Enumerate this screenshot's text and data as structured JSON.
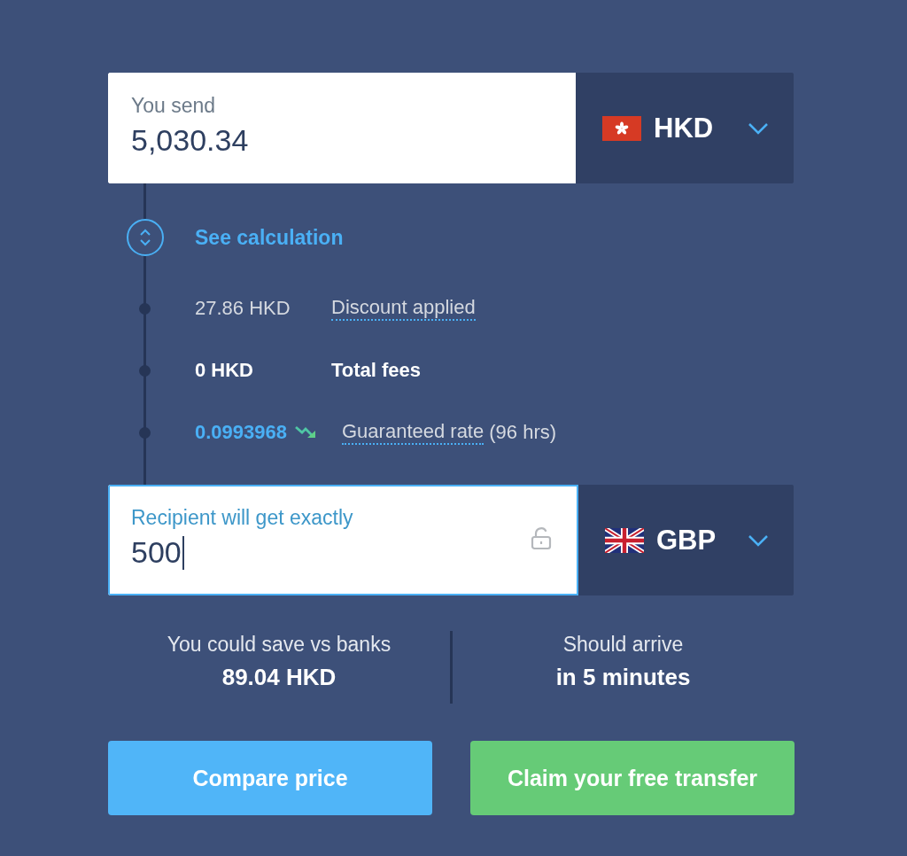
{
  "send": {
    "label": "You send",
    "value": "5,030.34",
    "currency": "HKD",
    "focused": false
  },
  "calculation": {
    "toggle": "See calculation",
    "rows": [
      {
        "kind": "discount",
        "amount": "27.86 HKD",
        "label": "Discount applied"
      },
      {
        "kind": "fees",
        "amount": "0 HKD",
        "label": "Total fees"
      },
      {
        "kind": "rate",
        "amount": "0.0993968",
        "label": "Guaranteed rate",
        "suffix": "(96 hrs)"
      }
    ]
  },
  "receive": {
    "label": "Recipient will get exactly",
    "value": "500",
    "currency": "GBP",
    "focused": true
  },
  "stats": [
    {
      "label": "You could save vs banks",
      "value": "89.04 HKD"
    },
    {
      "label": "Should arrive",
      "value": "in 5 minutes"
    }
  ],
  "buttons": [
    {
      "label": "Compare price",
      "kind": "secondary"
    },
    {
      "label": "Claim your free transfer",
      "kind": "primary"
    }
  ]
}
